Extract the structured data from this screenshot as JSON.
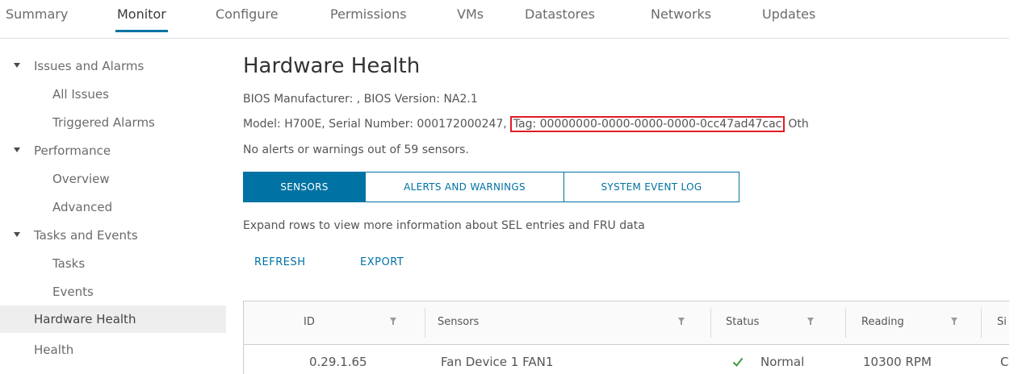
{
  "tabs": [
    {
      "label": "Summary"
    },
    {
      "label": "Monitor",
      "active": true
    },
    {
      "label": "Configure"
    },
    {
      "label": "Permissions"
    },
    {
      "label": "VMs"
    },
    {
      "label": "Datastores"
    },
    {
      "label": "Networks"
    },
    {
      "label": "Updates"
    }
  ],
  "sidebar": {
    "items": [
      {
        "label": "Issues and Alarms",
        "expandable": true
      },
      {
        "label": "All Issues"
      },
      {
        "label": "Triggered Alarms"
      },
      {
        "label": "Performance",
        "expandable": true
      },
      {
        "label": "Overview"
      },
      {
        "label": "Advanced"
      },
      {
        "label": "Tasks and Events",
        "expandable": true
      },
      {
        "label": "Tasks"
      },
      {
        "label": "Events"
      },
      {
        "label": "Hardware Health",
        "selected": true
      },
      {
        "label": "Health"
      }
    ]
  },
  "main": {
    "title": "Hardware Health",
    "bios_line": "BIOS Manufacturer: , BIOS Version: NA2.1",
    "model_line_prefix": "Model: H700E, Serial Number: 000172000247,",
    "tag_text": "Tag: 00000000-0000-0000-0000-0cc47ad47cac",
    "model_line_suffix": "Oth",
    "alerts_summary": "No alerts or warnings out of 59 sensors.",
    "segments": [
      {
        "label": "SENSORS",
        "active": true
      },
      {
        "label": "ALERTS AND WARNINGS"
      },
      {
        "label": "SYSTEM EVENT LOG"
      }
    ],
    "expand_hint": "Expand rows to view more information about SEL entries and FRU data",
    "actions": {
      "refresh": "REFRESH",
      "export": "EXPORT"
    },
    "table": {
      "columns": [
        "ID",
        "Sensors",
        "Status",
        "Reading",
        "Si"
      ],
      "rows": [
        {
          "id": "0.29.1.65",
          "sensor": "Fan Device 1 FAN1",
          "status": "Normal",
          "reading": "10300 RPM",
          "extra": "C"
        }
      ]
    }
  },
  "colors": {
    "accent": "#0072a3",
    "highlight_box": "#e01b24",
    "status_ok": "#3f9b3f"
  }
}
